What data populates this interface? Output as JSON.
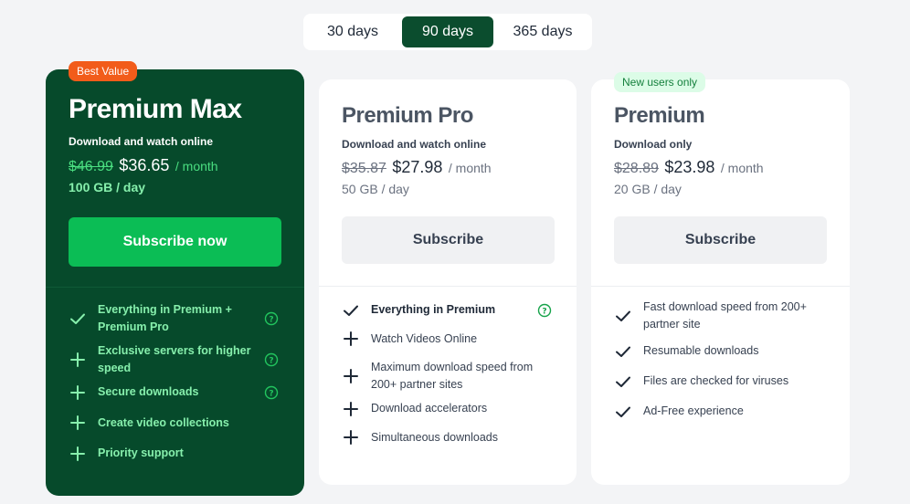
{
  "period": {
    "options": [
      "30 days",
      "90 days",
      "365 days"
    ],
    "selected": "90 days"
  },
  "plans": [
    {
      "badge": "Best Value",
      "title": "Premium Max",
      "subtitle": "Download and watch online",
      "old_price": "$46.99",
      "price": "$36.65",
      "per": "/ month",
      "quota": "100 GB / day",
      "button": "Subscribe now",
      "features": [
        {
          "lines": [
            "Everything in Premium +",
            "Premium Pro"
          ],
          "icon": "check-icon",
          "help": true
        },
        {
          "lines": [
            "Exclusive servers for higher",
            "speed"
          ],
          "icon": "plus-icon",
          "help": true
        },
        {
          "lines": [
            "Secure downloads"
          ],
          "icon": "plus-icon",
          "help": true
        },
        {
          "lines": [
            "Create video collections"
          ],
          "icon": "plus-icon",
          "help": false
        },
        {
          "lines": [
            "Priority support"
          ],
          "icon": "plus-icon",
          "help": false
        }
      ]
    },
    {
      "title": "Premium Pro",
      "subtitle": "Download and watch online",
      "old_price": "$35.87",
      "price": "$27.98",
      "per": "/ month",
      "quota": "50 GB / day",
      "button": "Subscribe",
      "features": [
        {
          "lines": [
            "Everything in Premium"
          ],
          "icon": "check-icon",
          "help": true
        },
        {
          "lines": [
            "Watch Videos Online"
          ],
          "icon": "plus-icon",
          "help": false
        },
        {
          "lines": [
            "Maximum download speed from",
            "200+ partner sites"
          ],
          "icon": "plus-icon",
          "help": false
        },
        {
          "lines": [
            "Download accelerators"
          ],
          "icon": "plus-icon",
          "help": false
        },
        {
          "lines": [
            "Simultaneous downloads"
          ],
          "icon": "plus-icon",
          "help": false
        }
      ]
    },
    {
      "badge": "New users only",
      "title": "Premium",
      "subtitle": "Download only",
      "old_price": "$28.89",
      "price": "$23.98",
      "per": "/ month",
      "quota": "20 GB / day",
      "button": "Subscribe",
      "features": [
        {
          "lines": [
            "Fast download speed from 200+",
            "partner site"
          ],
          "icon": "check-icon",
          "help": false
        },
        {
          "lines": [
            "Resumable downloads"
          ],
          "icon": "check-icon",
          "help": false
        },
        {
          "lines": [
            "Files are checked for viruses"
          ],
          "icon": "check-icon",
          "help": false
        },
        {
          "lines": [
            "Ad-Free experience"
          ],
          "icon": "check-icon",
          "help": false
        }
      ]
    }
  ],
  "colors": {
    "brand_dark_green": "#064a2b",
    "toggle_active": "#0b4d2e",
    "cta_green": "#0bbd55",
    "best_value_badge": "#f25c1a",
    "highlight_green": "#86efac"
  }
}
